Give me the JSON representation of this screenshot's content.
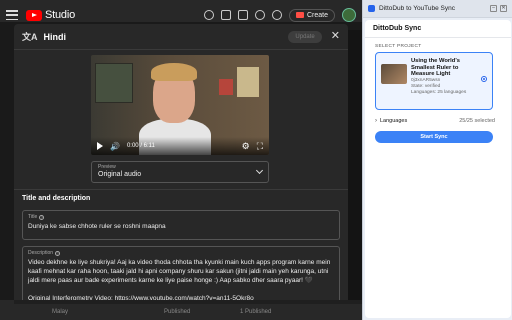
{
  "studio": {
    "logo_text": "Studio",
    "create_label": "Create",
    "footer": {
      "col1": "Malay",
      "col2": "Published",
      "col3": "1 Published"
    }
  },
  "dialog": {
    "title": "Hindi",
    "update_label": "Update",
    "video": {
      "time": "0:00 / 6:11"
    },
    "preview": {
      "label": "Preview",
      "value": "Original audio"
    },
    "section_title": "Title and description",
    "title_field": {
      "label": "Title",
      "value": "Duniya ke sabse chhote ruler se roshni maapna"
    },
    "description_field": {
      "label": "Description",
      "value": "Video dekhne ke liye shukriya! Aaj ka video thoda chhota tha kyunki main kuch apps program karne mein kaafi mehnat kar raha hoon, taaki jald hi apni company shuru kar sakun (jitni jaldi main yeh karunga, utni jaldi mere paas aur bade experiments karne ke liye paise honge :) Aap sabko dher saara pyaar! 🖤\n\nOriginal Interferometry Video: https://www.youtube.com/watch?v=an11-5Okr8o"
    }
  },
  "extension": {
    "window_title": "DittoDub to YouTube Sync",
    "header_title": "DittoDub Sync",
    "select_project_label": "SELECT PROJECT",
    "project": {
      "title": "Using the World's Smallest Ruler to Measure Light",
      "id": "0j3xnAR5wsn",
      "state": "State: verified",
      "languages": "Languages: 25 languages"
    },
    "languages_label": "Languages",
    "languages_count": "25/25 selected",
    "start_label": "Start Sync"
  }
}
